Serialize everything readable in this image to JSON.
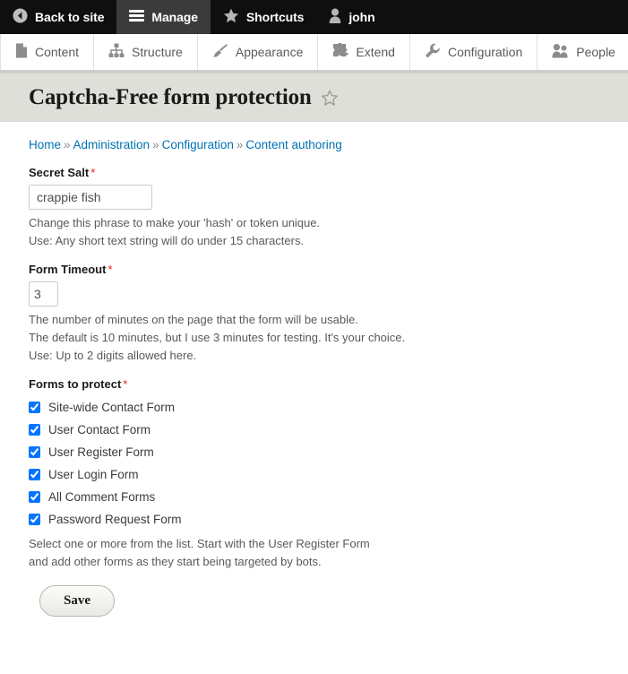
{
  "admin_bar": {
    "items": [
      {
        "label": "Back to site",
        "icon": "back-arrow-circle-icon",
        "active": false
      },
      {
        "label": "Manage",
        "icon": "hamburger-menu-icon",
        "active": true
      },
      {
        "label": "Shortcuts",
        "icon": "star-icon",
        "active": false
      },
      {
        "label": "john",
        "icon": "user-account-icon",
        "active": false
      }
    ]
  },
  "admin_menu": {
    "items": [
      {
        "label": "Content",
        "icon": "document-icon"
      },
      {
        "label": "Structure",
        "icon": "sitemap-icon"
      },
      {
        "label": "Appearance",
        "icon": "paintbrush-icon"
      },
      {
        "label": "Extend",
        "icon": "puzzle-piece-icon"
      },
      {
        "label": "Configuration",
        "icon": "wrench-icon"
      },
      {
        "label": "People",
        "icon": "people-icon"
      }
    ]
  },
  "page": {
    "title": "Captcha-Free form protection",
    "star_icon": "star-outline-icon"
  },
  "breadcrumb": {
    "separator": "»",
    "items": [
      "Home",
      "Administration",
      "Configuration",
      "Content authoring"
    ]
  },
  "form": {
    "secret_salt": {
      "label": "Secret Salt",
      "required_mark": "*",
      "value": "crappie fish",
      "placeholder": "",
      "description_line_1": "Change this phrase to make your 'hash' or token unique.",
      "description_line_2": "Use: Any short text string will do under 15 characters."
    },
    "form_timeout": {
      "label": "Form Timeout",
      "required_mark": "*",
      "value": "3",
      "placeholder": "",
      "description_line_1": "The number of minutes on the page that the form will be usable.",
      "description_line_2": "The default is 10 minutes, but I use 3 minutes for testing. It's your choice.",
      "description_line_3": "Use: Up to 2 digits allowed here."
    },
    "forms_to_protect": {
      "label": "Forms to protect",
      "required_mark": "*",
      "options": [
        {
          "label": "Site-wide Contact Form",
          "checked": true
        },
        {
          "label": "User Contact Form",
          "checked": true
        },
        {
          "label": "User Register Form",
          "checked": true
        },
        {
          "label": "User Login Form",
          "checked": true
        },
        {
          "label": "All Comment Forms",
          "checked": true
        },
        {
          "label": "Password Request Form",
          "checked": true
        }
      ],
      "description_line_1": "Select one or more from the list. Start with the User Register Form",
      "description_line_2": "and add other forms as they start being targeted by bots."
    },
    "save_label": "Save"
  },
  "colors": {
    "toolbar_bg": "#0f0f0f",
    "toolbar_active": "#3b3b3b",
    "title_bar_bg": "#dedfd9",
    "link_blue": "#0071b3",
    "required_red": "#e7230f",
    "description_gray": "#595959"
  }
}
